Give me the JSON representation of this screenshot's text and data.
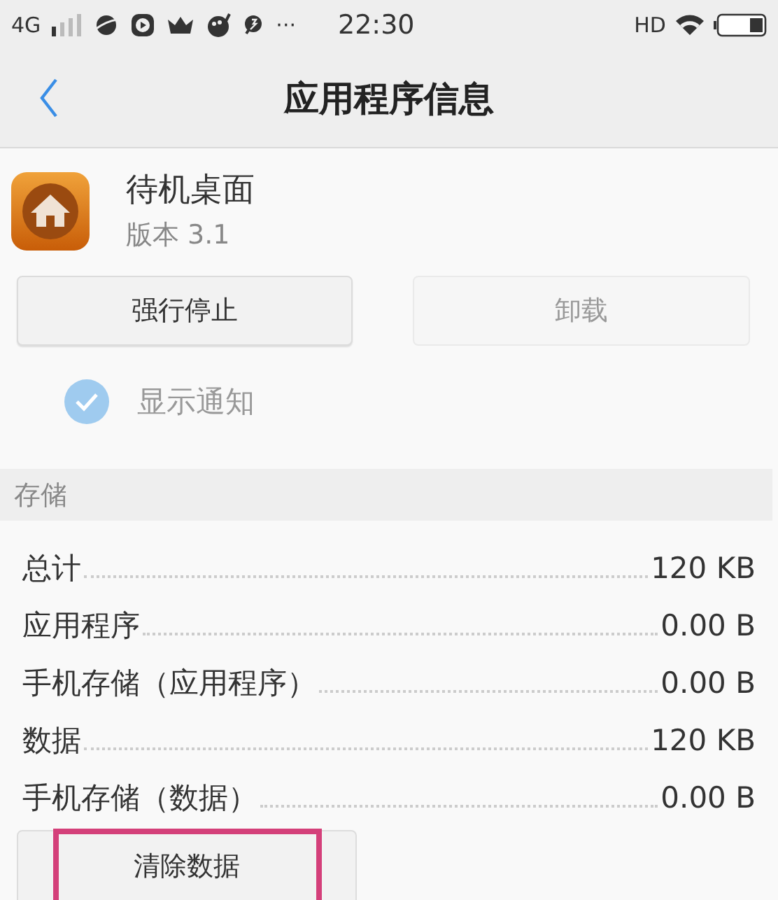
{
  "status_bar": {
    "network": "4G",
    "more": "···",
    "time": "22:30",
    "hd": "HD"
  },
  "header": {
    "title": "应用程序信息"
  },
  "app": {
    "name": "待机桌面",
    "version": "版本 3.1"
  },
  "buttons": [
    {
      "label": "强行停止",
      "disabled": false
    },
    {
      "label": "卸载",
      "disabled": true
    }
  ],
  "notification": {
    "label": "显示通知",
    "checked": true
  },
  "storage": {
    "title": "存储",
    "rows": [
      {
        "label": "总计",
        "value": "120 KB"
      },
      {
        "label": "应用程序",
        "value": "0.00 B"
      },
      {
        "label": "手机存储（应用程序）",
        "value": "0.00 B"
      },
      {
        "label": "数据",
        "value": "120 KB"
      },
      {
        "label": "手机存储（数据）",
        "value": "0.00 B"
      }
    ]
  },
  "clear_button": {
    "label": "清除数据",
    "highlighted": true
  }
}
